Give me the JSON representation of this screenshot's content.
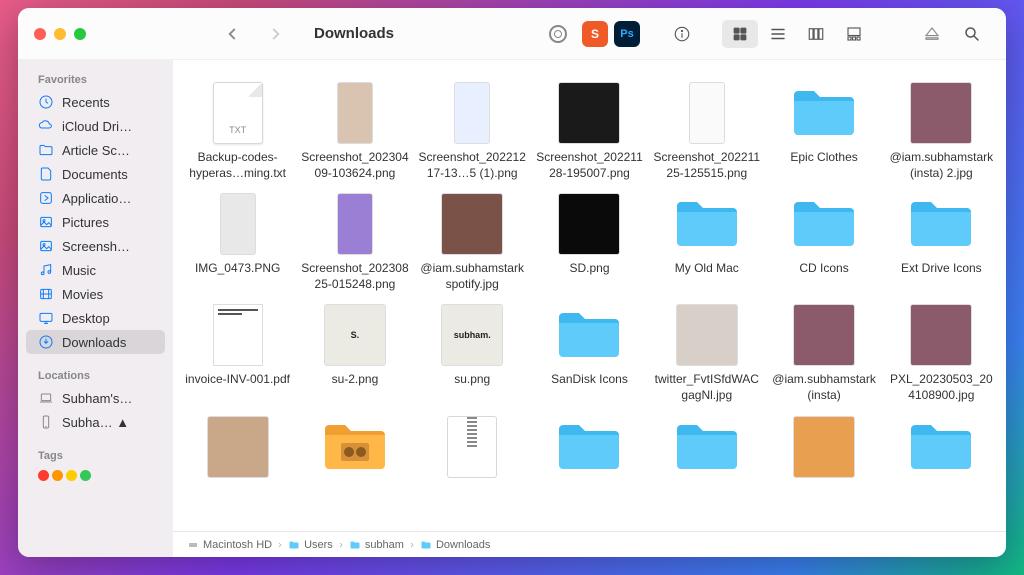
{
  "window_title": "Downloads",
  "sidebar": {
    "favorites_label": "Favorites",
    "locations_label": "Locations",
    "tags_label": "Tags",
    "items": [
      {
        "icon": "clock",
        "label": "Recents"
      },
      {
        "icon": "cloud",
        "label": "iCloud Dri…"
      },
      {
        "icon": "folder",
        "label": "Article Sc…"
      },
      {
        "icon": "doc",
        "label": "Documents"
      },
      {
        "icon": "app",
        "label": "Applicatio…"
      },
      {
        "icon": "picture",
        "label": "Pictures"
      },
      {
        "icon": "picture",
        "label": "Screensh…"
      },
      {
        "icon": "music",
        "label": "Music"
      },
      {
        "icon": "movie",
        "label": "Movies"
      },
      {
        "icon": "desktop",
        "label": "Desktop"
      },
      {
        "icon": "download",
        "label": "Downloads",
        "active": true
      }
    ],
    "locations": [
      {
        "icon": "laptop",
        "label": "Subham's…"
      },
      {
        "icon": "phone",
        "label": "Subha… ▲"
      }
    ]
  },
  "app_icons": {
    "s": "S",
    "ps": "Ps"
  },
  "files": [
    {
      "type": "txt",
      "label": "Backup-codes-hyperas…ming.txt"
    },
    {
      "type": "img-tall",
      "label": "Screenshot_20230409-103624.png",
      "bg": "#d8c4b0"
    },
    {
      "type": "img-tall",
      "label": "Screenshot_20221217-13…5 (1).png",
      "bg": "#e8f0ff"
    },
    {
      "type": "img",
      "label": "Screenshot_20221128-195007.png",
      "bg": "#1a1a1a"
    },
    {
      "type": "img-tall",
      "label": "Screenshot_20221125-125515.png",
      "bg": "#fafafa"
    },
    {
      "type": "folder",
      "label": "Epic Clothes"
    },
    {
      "type": "img",
      "label": "@iam.subhamstark (insta) 2.jpg",
      "bg": "#8b5a6b"
    },
    {
      "type": "img-tall",
      "label": "IMG_0473.PNG",
      "bg": "#e8e8e8"
    },
    {
      "type": "img-tall",
      "label": "Screenshot_20230825-015248.png",
      "bg": "#9b7fd4"
    },
    {
      "type": "img",
      "label": "@iam.subhamstark spotify.jpg",
      "bg": "#7a5248"
    },
    {
      "type": "img",
      "label": "SD.png",
      "bg": "#0a0a0a"
    },
    {
      "type": "folder",
      "label": "My Old Mac"
    },
    {
      "type": "folder",
      "label": "CD Icons"
    },
    {
      "type": "folder",
      "label": "Ext Drive Icons"
    },
    {
      "type": "pdf",
      "label": "invoice-INV-001.pdf"
    },
    {
      "type": "img",
      "label": "su-2.png",
      "bg": "#ecebe3",
      "text": "S."
    },
    {
      "type": "img",
      "label": "su.png",
      "bg": "#ecebe3",
      "text": "subham."
    },
    {
      "type": "folder",
      "label": "SanDisk Icons"
    },
    {
      "type": "img",
      "label": "twitter_FvtISfdWACgagNl.jpg",
      "bg": "#d8d0c8"
    },
    {
      "type": "img",
      "label": "@iam.subhamstark (insta)",
      "bg": "#8b5a6b"
    },
    {
      "type": "img",
      "label": "PXL_20230503_204108900.jpg",
      "bg": "#8b5a6b"
    },
    {
      "type": "img",
      "label": "",
      "bg": "#c8a888"
    },
    {
      "type": "folder-media",
      "label": ""
    },
    {
      "type": "zip",
      "label": ""
    },
    {
      "type": "folder",
      "label": ""
    },
    {
      "type": "folder",
      "label": ""
    },
    {
      "type": "img",
      "label": "",
      "bg": "#e8a050"
    },
    {
      "type": "folder",
      "label": ""
    }
  ],
  "path": [
    "Macintosh HD",
    "Users",
    "subham",
    "Downloads"
  ]
}
